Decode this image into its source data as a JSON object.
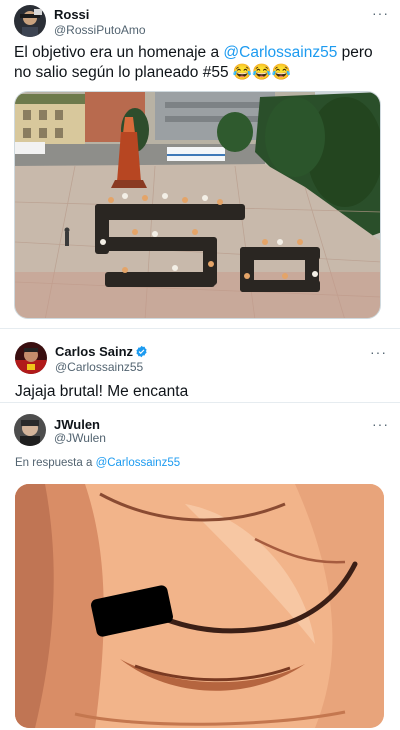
{
  "tweet1": {
    "name": "Rossi",
    "handle": "@RossiPutoAmo",
    "text_prefix": "El objetivo era un homenaje a ",
    "mention": "@Carlossainz55",
    "text_suffix": " pero no salio según lo planeado #55 😂😂😂",
    "more_icon": "more-dots"
  },
  "tweet2": {
    "name": "Carlos Sainz",
    "handle": "@Carlossainz55",
    "text": "Jajaja brutal! Me encanta",
    "verified": true
  },
  "tweet3": {
    "name": "JWulen",
    "handle": "@JWulen",
    "reply_prefix": "En respuesta a ",
    "reply_mention": "@Carlossainz55"
  },
  "colors": {
    "accent": "#1d9bf0",
    "text": "#0f1419",
    "muted": "#536471"
  }
}
